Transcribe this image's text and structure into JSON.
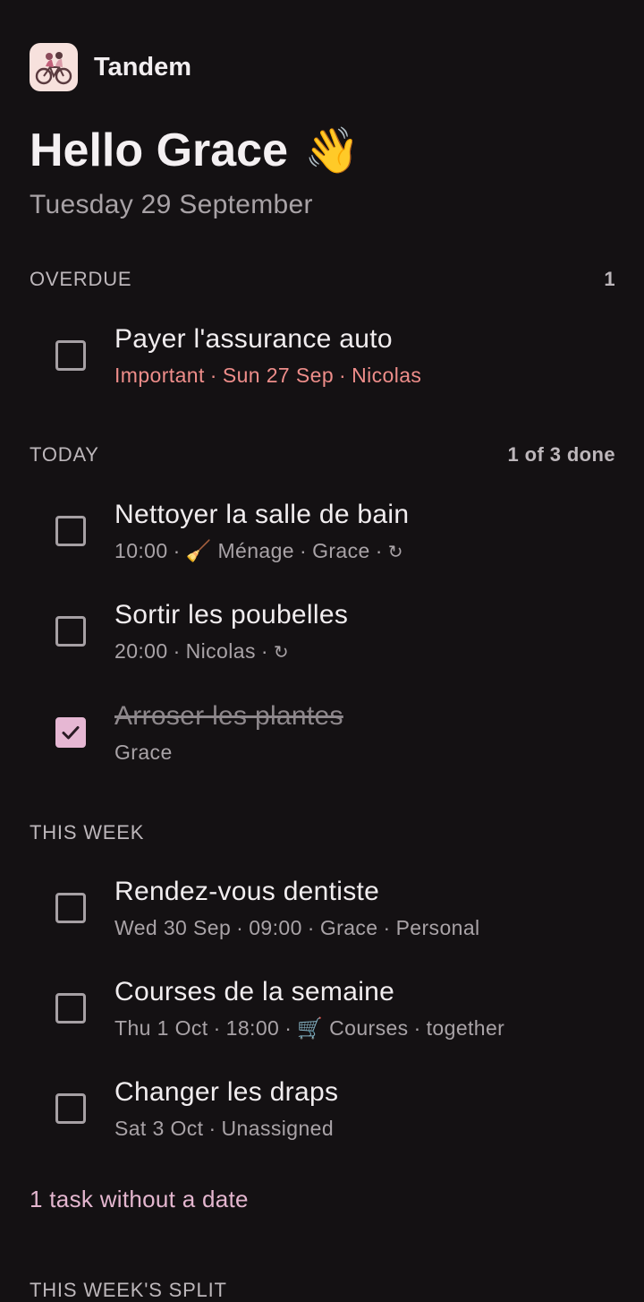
{
  "app": {
    "name": "Tandem",
    "logo_icon": "tandem-bicycle-logo-icon"
  },
  "greeting": {
    "title": "Hello Grace",
    "emoji": "👋",
    "date": "Tuesday 29 September"
  },
  "colors": {
    "background": "#141113",
    "accent": "#e6b7d3",
    "overdue": "#ee8d8a"
  },
  "sections": {
    "overdue": {
      "label": "OVERDUE",
      "count": "1",
      "tasks": [
        {
          "title": "Payer l'assurance auto",
          "tag": "Important",
          "date": "Sun 27 Sep",
          "assignee": "Nicolas",
          "done": false
        }
      ]
    },
    "today": {
      "label": "TODAY",
      "count": "1 of 3 done",
      "tasks": [
        {
          "title": "Nettoyer la salle de bain",
          "time": "10:00",
          "category_emoji": "🧹",
          "category": "Ménage",
          "assignee": "Grace",
          "repeat_icon": "↻",
          "done": false
        },
        {
          "title": "Sortir les poubelles",
          "time": "20:00",
          "assignee": "Nicolas",
          "repeat_icon": "↻",
          "done": false
        },
        {
          "title": "Arroser les plantes",
          "assignee": "Grace",
          "done": true
        }
      ]
    },
    "this_week": {
      "label": "THIS WEEK",
      "tasks": [
        {
          "title": "Rendez-vous dentiste",
          "date": "Wed 30 Sep",
          "time": "09:00",
          "assignee": "Grace",
          "list": "Personal",
          "done": false
        },
        {
          "title": "Courses de la semaine",
          "date": "Thu 1 Oct",
          "time": "18:00",
          "category_emoji": "🛒",
          "category": "Courses",
          "assignee": "together",
          "done": false
        },
        {
          "title": "Changer les draps",
          "date": "Sat 3 Oct",
          "assignee": "Unassigned",
          "done": false
        }
      ]
    }
  },
  "undated_link": "1 task without a date",
  "next_section_label": "THIS WEEK'S SPLIT"
}
